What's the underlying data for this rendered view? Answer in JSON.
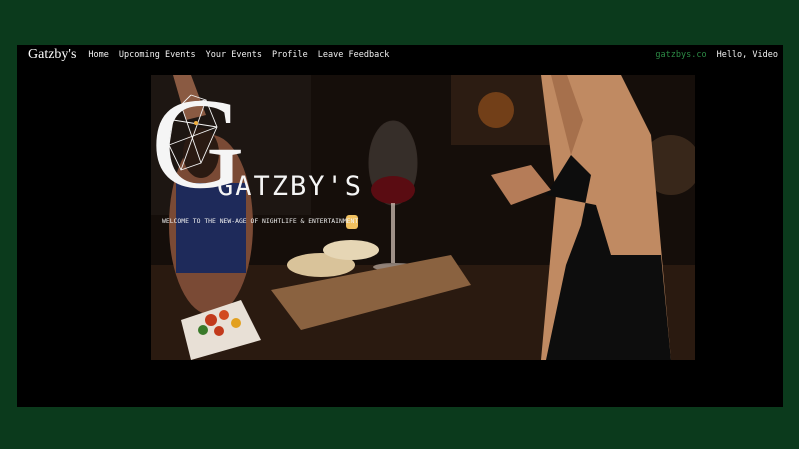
{
  "nav": {
    "brand": "Gatzby's",
    "links": [
      "Home",
      "Upcoming Events",
      "Your Events",
      "Profile",
      "Leave Feedback"
    ],
    "site_link": "gatzbys.co",
    "greeting": "Hello, Video"
  },
  "hero": {
    "title": "GATZBY'S",
    "tagline": "WELCOME TO THE NEW-AGE OF NIGHTLIFE & ENTERTAINMENT",
    "logo_letter": "G",
    "logo_icon": "lion-head-icon"
  },
  "colors": {
    "outer_background": "#0b3a1c",
    "frame_background": "#000000",
    "site_link": "#2c8a45"
  }
}
